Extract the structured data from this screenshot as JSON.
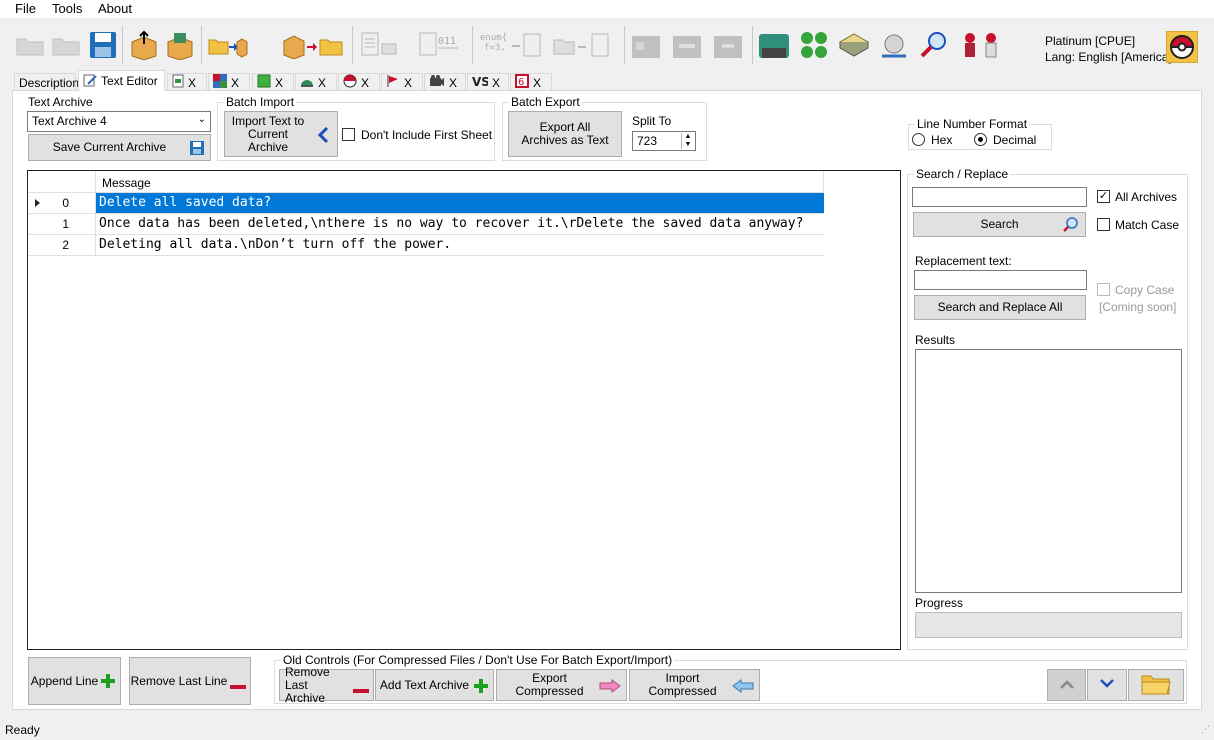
{
  "menu": {
    "file": "File",
    "tools": "Tools",
    "about": "About"
  },
  "rom": {
    "name": "Platinum [CPUE]",
    "lang": "Lang: English [America]"
  },
  "tabs": {
    "description": "Description",
    "text_editor": "Text Editor",
    "close": "X"
  },
  "text_archive": {
    "label": "Text Archive",
    "selected": "Text Archive 4",
    "save_button": "Save Current Archive"
  },
  "batch_import": {
    "title": "Batch Import",
    "import_button": "Import Text to Current Archive",
    "skip_first_sheet": "Don't Include First Sheet"
  },
  "batch_export": {
    "title": "Batch Export",
    "export_button": "Export All Archives as Text",
    "split_label": "Split To",
    "split_value": "723"
  },
  "line_format": {
    "title": "Line Number Format",
    "hex": "Hex",
    "decimal": "Decimal",
    "selected": "decimal"
  },
  "grid": {
    "column": "Message",
    "rows": [
      {
        "index": "0",
        "message": "Delete all saved data?"
      },
      {
        "index": "1",
        "message": "Once data has been deleted,\\nthere is no way to recover it.\\rDelete the saved data anyway?"
      },
      {
        "index": "2",
        "message": "Deleting all data.\\nDon’t turn off the power."
      }
    ]
  },
  "search": {
    "title": "Search / Replace",
    "all_archives": "All Archives",
    "match_case": "Match Case",
    "search_button": "Search",
    "replacement_label": "Replacement text:",
    "copy_case": "Copy Case",
    "coming_soon": "[Coming soon]",
    "replace_button": "Search and Replace All",
    "results_label": "Results",
    "progress_label": "Progress"
  },
  "bottom": {
    "append_line": "Append Line",
    "remove_last_line": "Remove Last Line",
    "old_controls_title": "Old Controls (For Compressed Files / Don't Use For Batch Export/Import)",
    "remove_last_archive": "Remove Last Archive",
    "add_text_archive": "Add Text Archive",
    "export_compressed": "Export Compressed",
    "import_compressed": "Import Compressed"
  },
  "status": "Ready",
  "colors": {
    "selection": "#0078d7",
    "plus": "#1e9e1e",
    "minus": "#c8102e",
    "folder": "#f3c245"
  }
}
